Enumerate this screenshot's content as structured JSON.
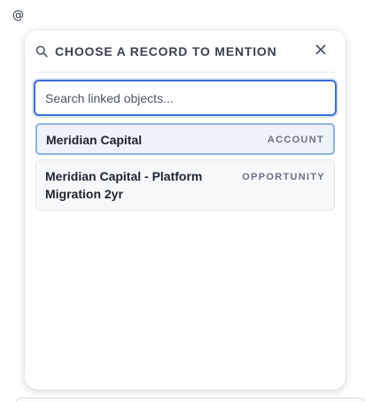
{
  "trigger": {
    "text": "@"
  },
  "popover": {
    "title": "CHOOSE A RECORD TO MENTION",
    "search": {
      "placeholder": "Search linked objects...",
      "value": ""
    },
    "results": [
      {
        "name": "Meridian Capital",
        "type": "ACCOUNT",
        "selected": true
      },
      {
        "name": "Meridian Capital - Platform Migration 2yr",
        "type": "OPPORTUNITY",
        "selected": false
      }
    ]
  },
  "icons": {
    "search": "search-icon",
    "close": "close-icon"
  },
  "colors": {
    "accent": "#3b6fd4",
    "selected_bg": "#eef3fb",
    "selected_border": "#8fb0e6",
    "title_text": "#3b4250",
    "type_text": "#6b7280"
  }
}
